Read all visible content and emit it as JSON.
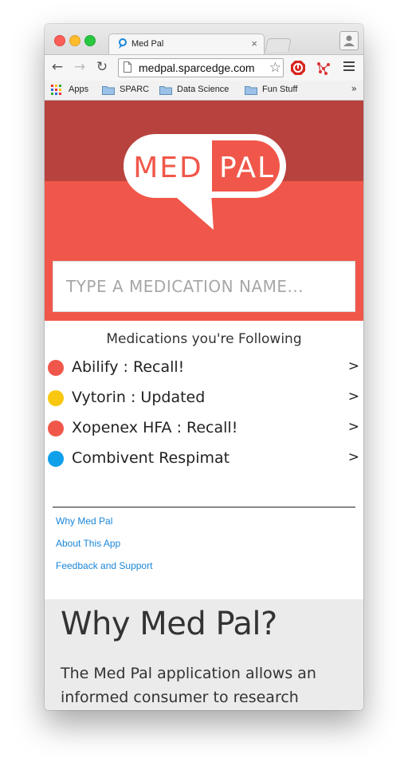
{
  "browser": {
    "tab_title": "Med Pal",
    "tab_close": "×",
    "url": "medpal.sparcedge.com",
    "nav": {
      "back": "←",
      "forward": "→",
      "reload": "↻"
    },
    "bookmarks": [
      {
        "label": "Apps",
        "icon": "apps-grid-icon"
      },
      {
        "label": "SPARC",
        "icon": "folder-icon"
      },
      {
        "label": "Data Science",
        "icon": "folder-icon"
      },
      {
        "label": "Fun Stuff",
        "icon": "folder-icon"
      }
    ],
    "bookmarks_overflow": "»"
  },
  "app": {
    "logo": {
      "left": "MED",
      "right": "PAL"
    },
    "search": {
      "placeholder": "TYPE A MEDICATION NAME..."
    },
    "following_title": "Medications you're Following",
    "medications": [
      {
        "label": "Abilify : Recall!",
        "status": "recall",
        "color": "#f0574a"
      },
      {
        "label": "Vytorin : Updated",
        "status": "updated",
        "color": "#f9c80e"
      },
      {
        "label": "Xopenex HFA : Recall!",
        "status": "recall",
        "color": "#f0574a"
      },
      {
        "label": "Combivent Respimat",
        "status": "normal",
        "color": "#0fa0ea"
      }
    ],
    "row_chevron": ">",
    "footer_links": [
      "Why Med Pal",
      "About This App",
      "Feedback and Support"
    ],
    "why": {
      "heading": "Why Med Pal?",
      "body": "The Med Pal application allows an informed consumer to research"
    }
  },
  "colors": {
    "brand_dark": "#b8423e",
    "brand": "#f0574a",
    "link": "#1a86d8"
  }
}
